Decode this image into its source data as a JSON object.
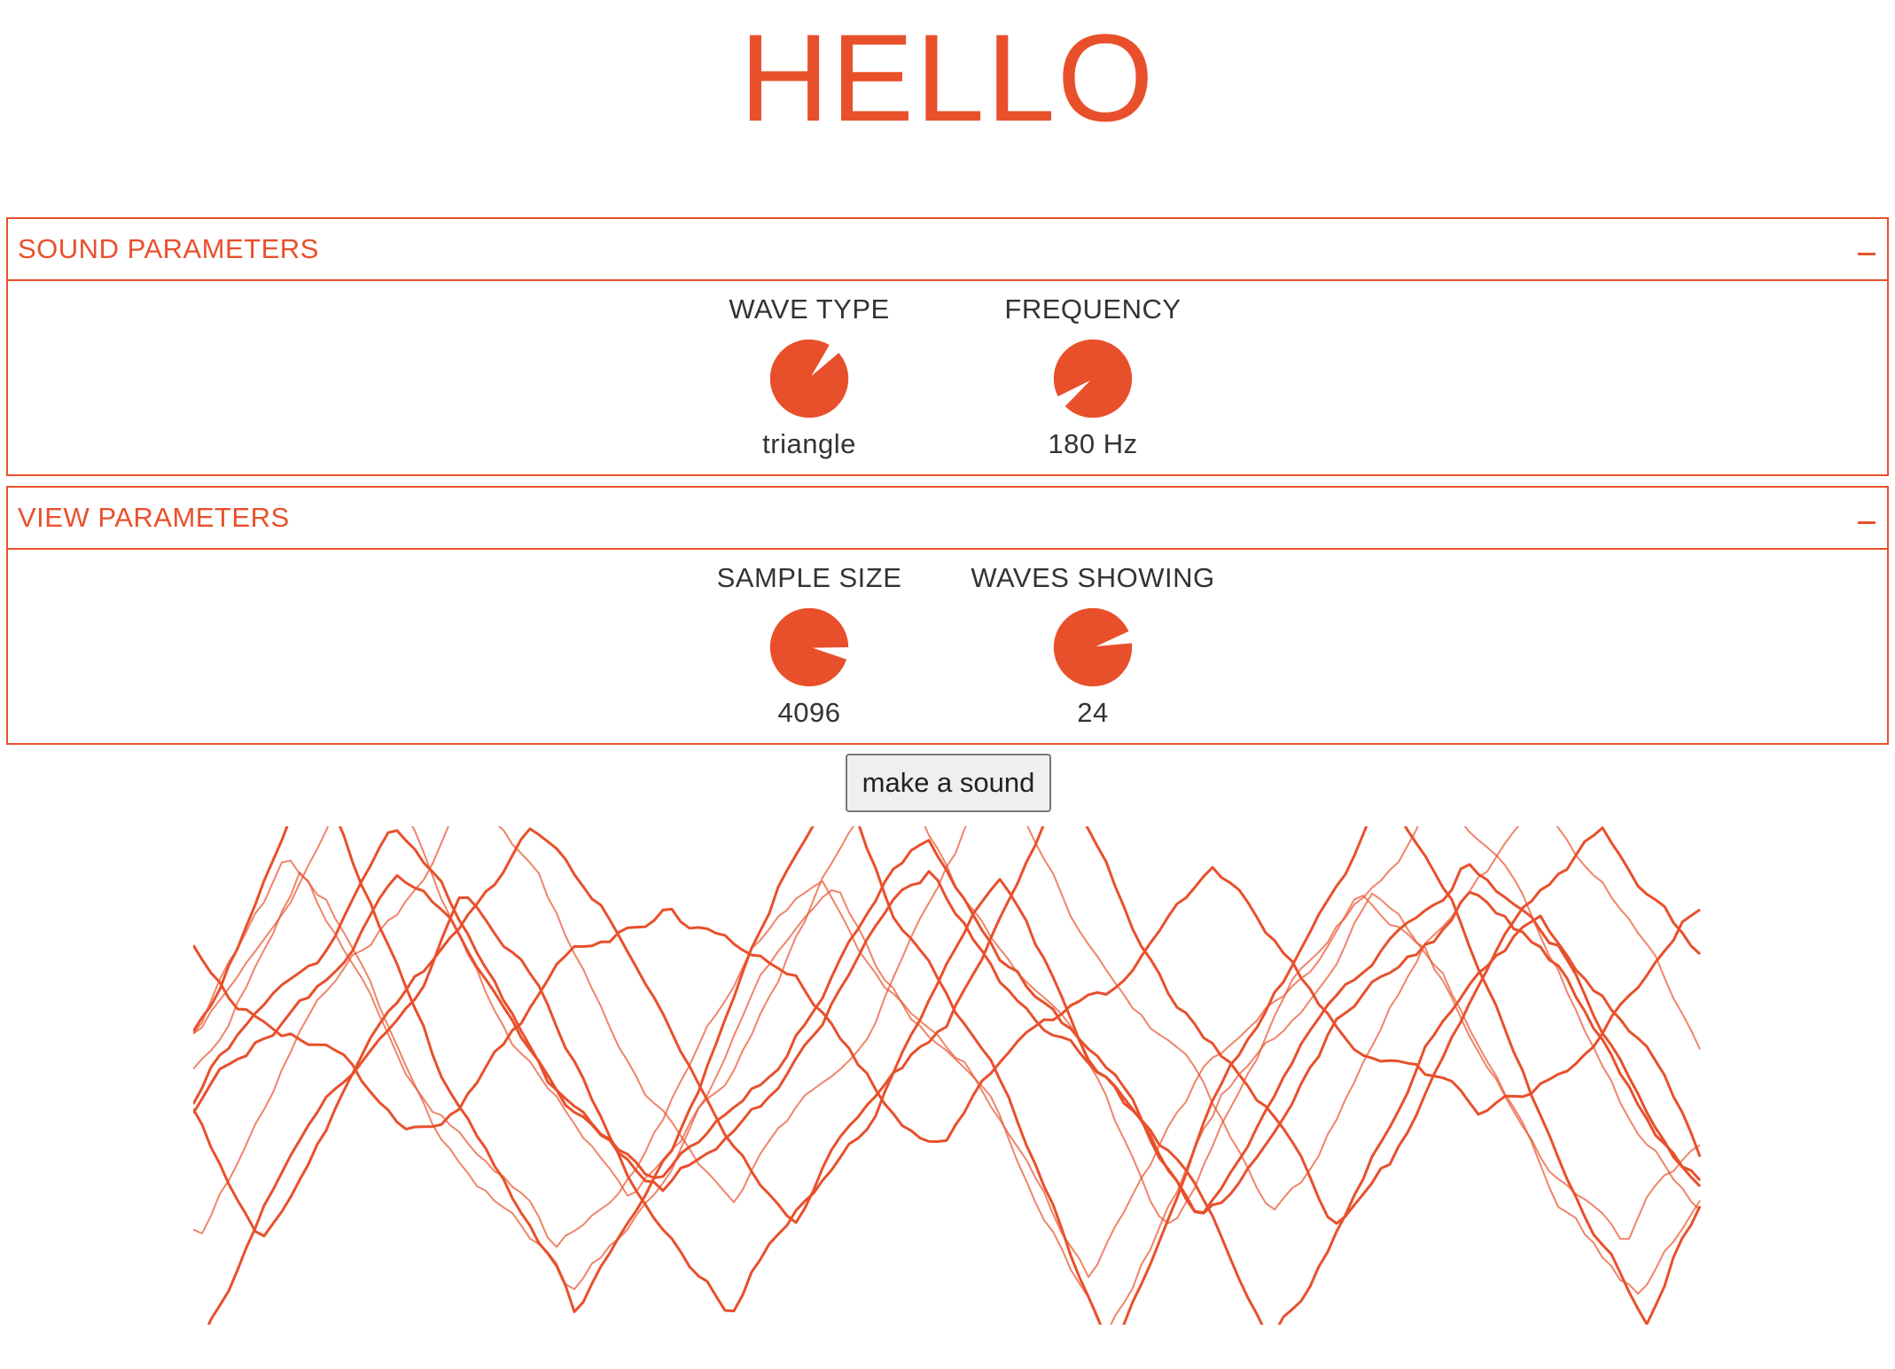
{
  "title": "HELLO",
  "colors": {
    "accent": "#e8502b",
    "text": "#333333"
  },
  "sound_parameters": {
    "header": "SOUND PARAMETERS",
    "collapse_icon": "minus-icon",
    "wave_type": {
      "label": "WAVE TYPE",
      "value": "triangle",
      "options_count": 4,
      "option_index": 2
    },
    "frequency": {
      "label": "FREQUENCY",
      "value": "180 Hz",
      "level": 0.08
    }
  },
  "view_parameters": {
    "header": "VIEW PARAMETERS",
    "collapse_icon": "minus-icon",
    "sample_size": {
      "label": "SAMPLE SIZE",
      "value": "4096",
      "level": 0.83
    },
    "waves_showing": {
      "label": "WAVES SHOWING",
      "value": "24",
      "level": 0.75
    }
  },
  "button": {
    "label": "make a sound"
  },
  "oscilloscope": {
    "wave_type": "triangle",
    "waves_showing": 24,
    "visible_traces": 10
  }
}
